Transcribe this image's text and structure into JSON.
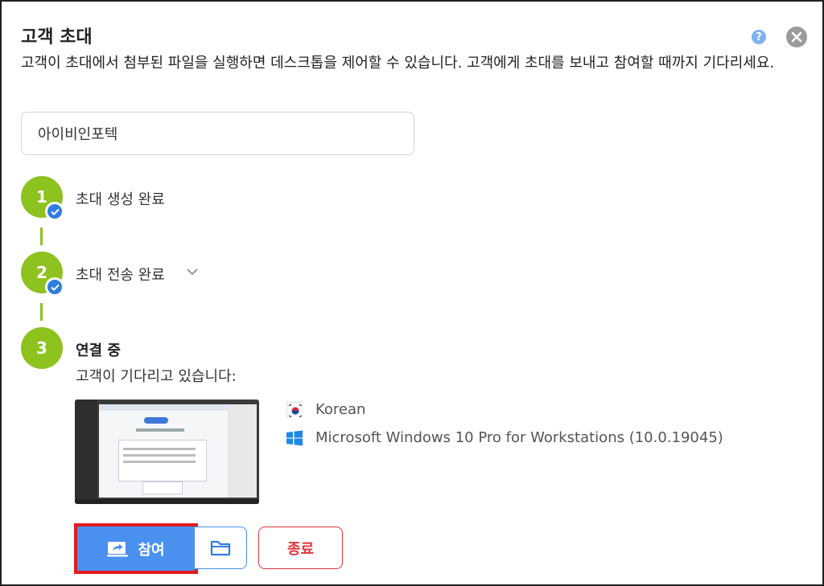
{
  "dialog": {
    "title": "고객 초대",
    "description": "고객이 초대에서 첨부된 파일을 실행하면 데스크톱을 제어할 수 있습니다. 고객에게 초대를 보내고 참여할 때까지 기다리세요.",
    "help_icon": "question-icon",
    "close_icon": "close-icon"
  },
  "name_input": {
    "value": "아이비인포텍"
  },
  "steps": [
    {
      "number": "1",
      "label": "초대 생성 완료",
      "status": "done"
    },
    {
      "number": "2",
      "label": "초대 전송 완료",
      "status": "done"
    },
    {
      "number": "3",
      "label": "연결 중",
      "status": "active"
    }
  ],
  "waiting_text": "고객이 기다리고 있습니다:",
  "client": {
    "language": "Korean",
    "os": "Microsoft Windows 10 Pro for Workstations (10.0.19045)"
  },
  "actions": {
    "join_label": "참여",
    "end_label": "종료"
  },
  "colors": {
    "step_green": "#8dc21f",
    "primary_blue": "#4a90ee",
    "danger_red": "#e0353a",
    "highlight_red": "#e21b1b"
  }
}
